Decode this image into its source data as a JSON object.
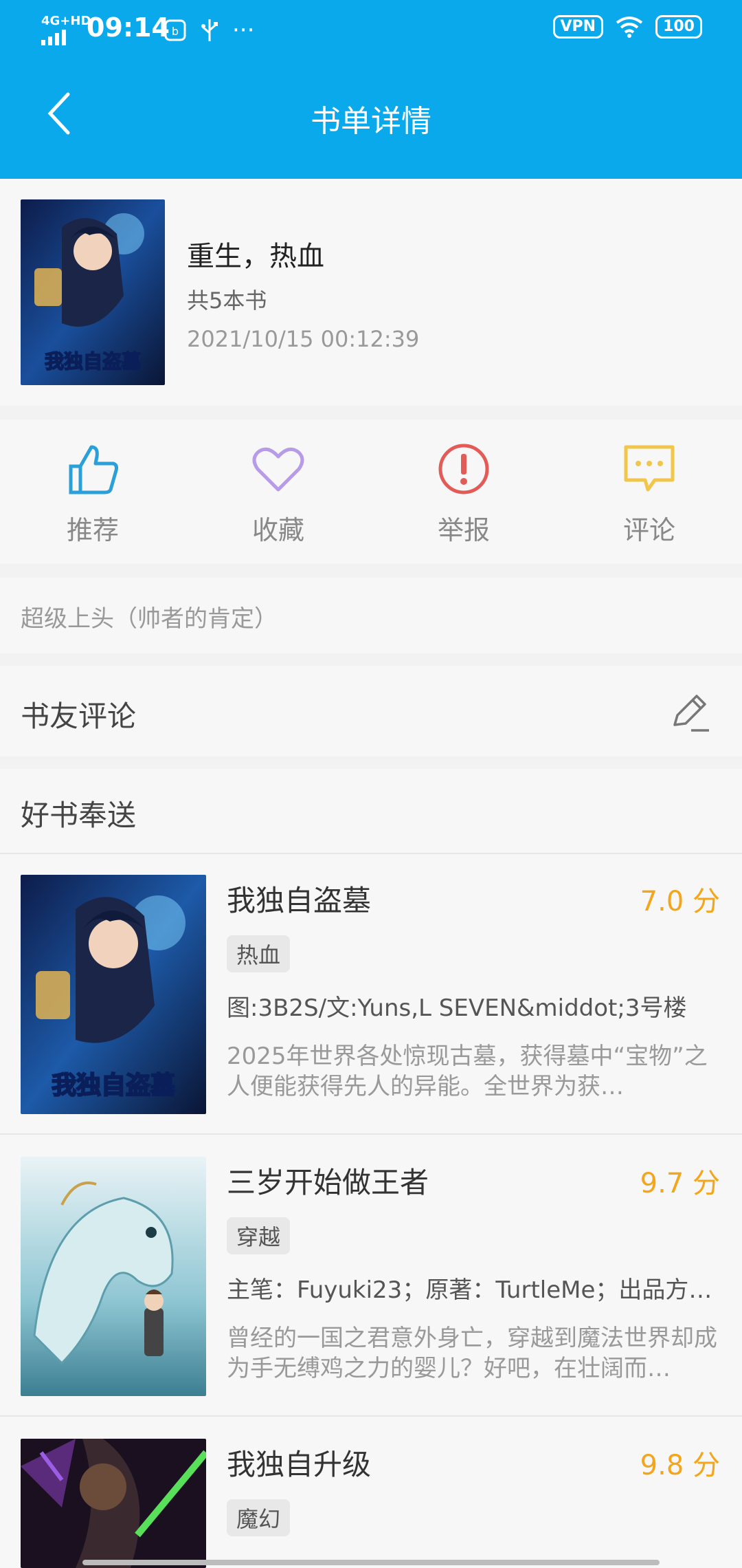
{
  "status_bar": {
    "signal": "4G+HD",
    "time": "09:14",
    "vpn": "VPN",
    "battery": "100"
  },
  "header": {
    "title": "书单详情"
  },
  "booklist": {
    "name": "重生，热血",
    "count": "共5本书",
    "datetime": "2021/10/15 00:12:39"
  },
  "actions": [
    {
      "label": "推荐",
      "icon": "thumbs-up-icon",
      "color": "#2a9fd8"
    },
    {
      "label": "收藏",
      "icon": "heart-icon",
      "color": "#b79be9"
    },
    {
      "label": "举报",
      "icon": "exclamation-circle-icon",
      "color": "#e35b57"
    },
    {
      "label": "评论",
      "icon": "chat-bubble-icon",
      "color": "#f2c64a"
    }
  ],
  "description": "超级上头（帅者的肯定）",
  "comments": {
    "title": "书友评论"
  },
  "recommended": {
    "title": "好书奉送",
    "books": [
      {
        "name": "我独自盗墓",
        "score": "7.0 分",
        "tag": "热血",
        "authors": "图:3B2S/文:Yuns,L SEVEN&middot;3号楼",
        "intro": "2025年世界各处惊现古墓，获得墓中“宝物”之人便能获得先人的异能。全世界为获…"
      },
      {
        "name": "三岁开始做王者",
        "score": "9.7 分",
        "tag": "穿越",
        "authors": "主笔：Fuyuki23；原著：TurtleMe；出品方…",
        "intro": "曾经的一国之君意外身亡，穿越到魔法世界却成为手无缚鸡之力的婴儿？好吧，在壮阔而…"
      },
      {
        "name": "我独自升级",
        "score": "9.8 分",
        "tag": "魔幻",
        "authors": "",
        "intro": ""
      }
    ]
  },
  "colors": {
    "header_bg": "#0aa9ec",
    "score": "#f3a51b"
  }
}
